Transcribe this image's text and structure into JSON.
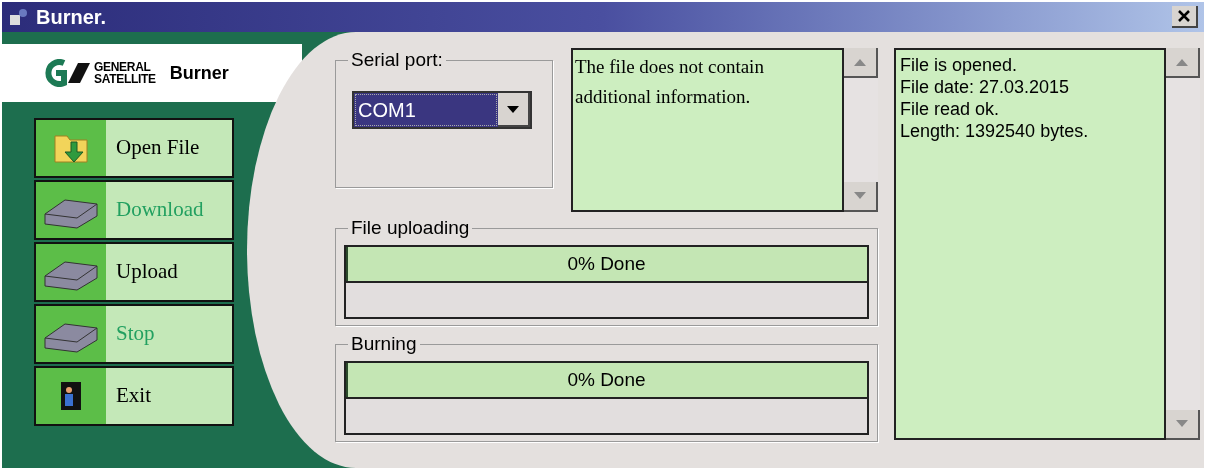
{
  "window": {
    "title": "Burner."
  },
  "brand": {
    "line_1": "GENERAL",
    "line_2": "SATELLITE",
    "app_name": "Burner"
  },
  "buttons": [
    {
      "label": "Open File",
      "kind": "folder",
      "disabled": false
    },
    {
      "label": "Download",
      "kind": "drive",
      "disabled": true
    },
    {
      "label": "Upload",
      "kind": "drive",
      "disabled": false
    },
    {
      "label": "Stop",
      "kind": "drive",
      "disabled": true
    },
    {
      "label": "Exit",
      "kind": "exit",
      "disabled": false
    }
  ],
  "serial_port": {
    "label": "Serial port:",
    "value": "COM1"
  },
  "file_info": {
    "text": "The file does not contain additional information."
  },
  "progress": [
    {
      "label": "File uploading",
      "reading": "0% Done",
      "level": 0
    },
    {
      "label": "Burning",
      "reading": "0% Done",
      "level": 0
    }
  ],
  "log": {
    "lines": [
      "File is opened.",
      "File date: 27.03.2015",
      "File read ok.",
      "Length: 1392540 bytes."
    ]
  }
}
